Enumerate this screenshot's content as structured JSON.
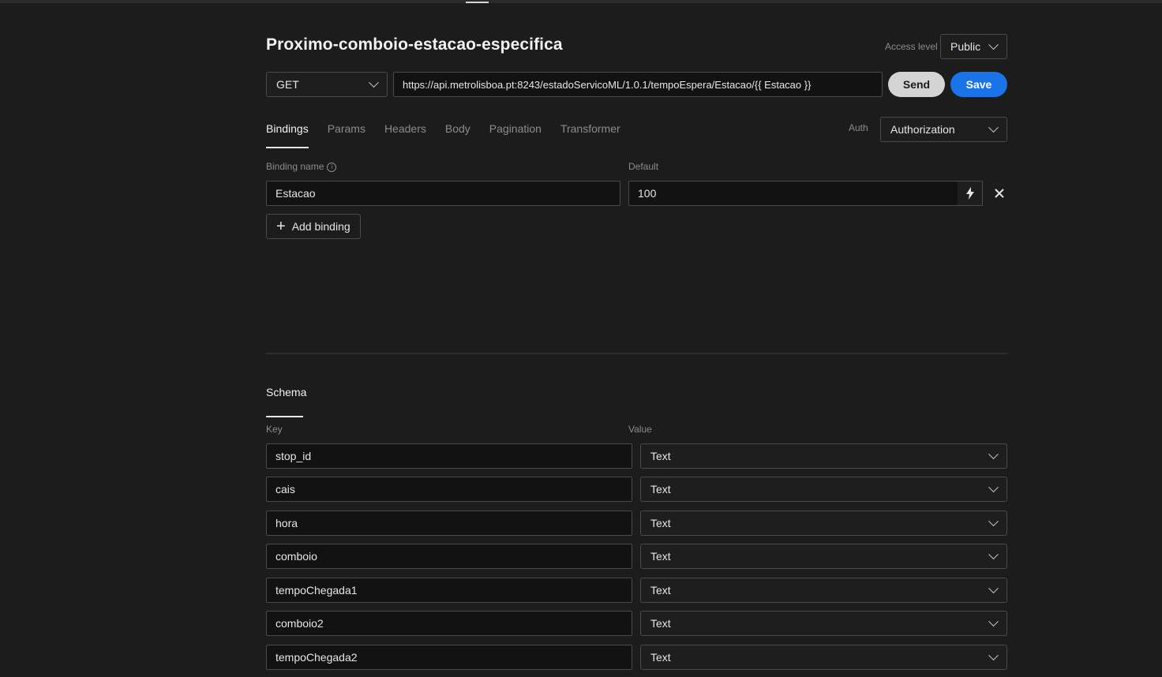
{
  "page": {
    "title": "Proximo-comboio-estacao-especifica"
  },
  "access": {
    "label": "Access level",
    "value": "Public"
  },
  "request": {
    "method": "GET",
    "url": "https://api.metrolisboa.pt:8243/estadoServicoML/1.0.1/tempoEspera/Estacao/{{ Estacao }}",
    "send_label": "Send",
    "save_label": "Save"
  },
  "tabs": [
    {
      "label": "Bindings"
    },
    {
      "label": "Params"
    },
    {
      "label": "Headers"
    },
    {
      "label": "Body"
    },
    {
      "label": "Pagination"
    },
    {
      "label": "Transformer"
    }
  ],
  "auth": {
    "label": "Auth",
    "value": "Authorization"
  },
  "bindings": {
    "name_label": "Binding name",
    "default_label": "Default",
    "name_value": "Estacao",
    "default_value": "100",
    "add_label": "Add binding"
  },
  "schema": {
    "tab_label": "Schema",
    "key_label": "Key",
    "value_label": "Value",
    "rows": [
      {
        "key": "stop_id",
        "type": "Text"
      },
      {
        "key": "cais",
        "type": "Text"
      },
      {
        "key": "hora",
        "type": "Text"
      },
      {
        "key": "comboio",
        "type": "Text"
      },
      {
        "key": "tempoChegada1",
        "type": "Text"
      },
      {
        "key": "comboio2",
        "type": "Text"
      },
      {
        "key": "tempoChegada2",
        "type": "Text"
      }
    ]
  },
  "colors": {
    "accent": "#1a73e8",
    "background": "#1c1c1c",
    "input_bg": "#121212",
    "border": "#4a4a4a"
  },
  "icons": {
    "info": "info-icon",
    "bolt": "bolt-icon",
    "close": "close-icon",
    "plus": "plus-icon",
    "chevron": "chevron-down-icon"
  }
}
